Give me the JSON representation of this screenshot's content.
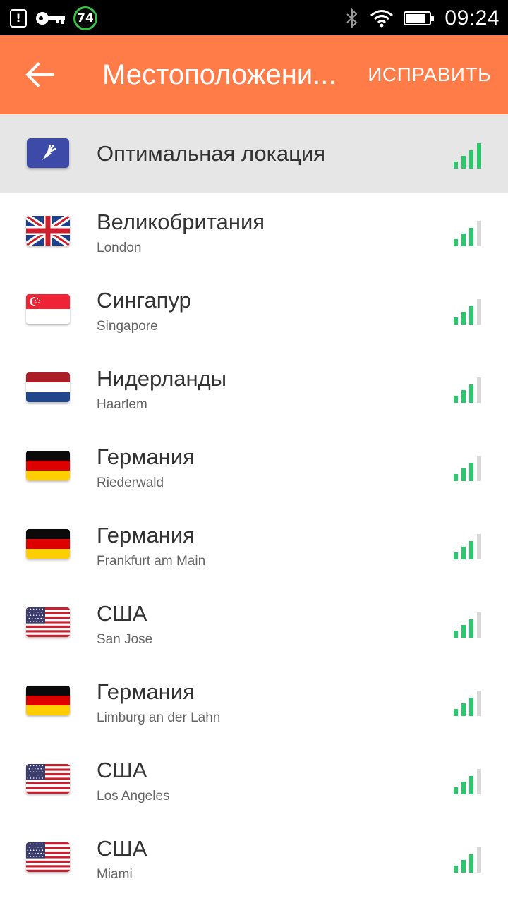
{
  "status_bar": {
    "battery_badge": "74",
    "time": "09:24",
    "icons": [
      "alert-icon",
      "key-icon",
      "bluetooth-icon",
      "wifi-icon",
      "battery-icon"
    ]
  },
  "app_bar": {
    "title": "Местоположени...",
    "action": "ИСПРАВИТЬ",
    "accent_color": "#ff7b47"
  },
  "optimal": {
    "label": "Оптимальная локация",
    "icon": "carrot-icon",
    "signal_level": 4
  },
  "locations": [
    {
      "country": "Великобритания",
      "city": "London",
      "flag": "uk",
      "signal_level": 3
    },
    {
      "country": "Сингапур",
      "city": "Singapore",
      "flag": "sg",
      "signal_level": 3
    },
    {
      "country": "Нидерланды",
      "city": "Haarlem",
      "flag": "nl",
      "signal_level": 3
    },
    {
      "country": "Германия",
      "city": "Riederwald",
      "flag": "de",
      "signal_level": 3
    },
    {
      "country": "Германия",
      "city": "Frankfurt am Main",
      "flag": "de",
      "signal_level": 3
    },
    {
      "country": "США",
      "city": "San Jose",
      "flag": "us",
      "signal_level": 3
    },
    {
      "country": "Германия",
      "city": "Limburg an der Lahn",
      "flag": "de",
      "signal_level": 3
    },
    {
      "country": "США",
      "city": "Los Angeles",
      "flag": "us",
      "signal_level": 3
    },
    {
      "country": "США",
      "city": "Miami",
      "flag": "us",
      "signal_level": 3
    }
  ],
  "colors": {
    "signal_on": "#2bc76c",
    "signal_off": "#d9d9d9",
    "optimal_bg": "#e6e6e6"
  }
}
